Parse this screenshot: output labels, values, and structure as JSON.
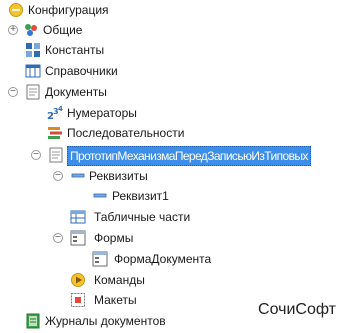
{
  "tree": {
    "root": "Конфигурация",
    "general": "Общие",
    "constants": "Константы",
    "catalogs": "Справочники",
    "documents": "Документы",
    "numerators": "Нумераторы",
    "sequences": "Последовательности",
    "doc_item": "ПрототипМеханизмаПередЗаписьюИзТиповых",
    "requisites": "Реквизиты",
    "requisite1": "Реквизит1",
    "tabular_parts": "Табличные части",
    "forms": "Формы",
    "doc_form": "ФормаДокумента",
    "commands": "Команды",
    "layouts": "Макеты",
    "journals": "Журналы документов"
  },
  "watermark": "СочиСофт",
  "colors": {
    "selection": "#3d8ee8",
    "text": "#1a1a1a"
  },
  "icons": [
    "config-root-icon",
    "general-icon",
    "constants-icon",
    "catalogs-icon",
    "documents-icon",
    "numerators-icon",
    "sequences-icon",
    "document-icon",
    "requisites-icon",
    "requisite-icon",
    "tabular-parts-icon",
    "forms-icon",
    "form-icon",
    "commands-icon",
    "layouts-icon",
    "journals-icon"
  ]
}
